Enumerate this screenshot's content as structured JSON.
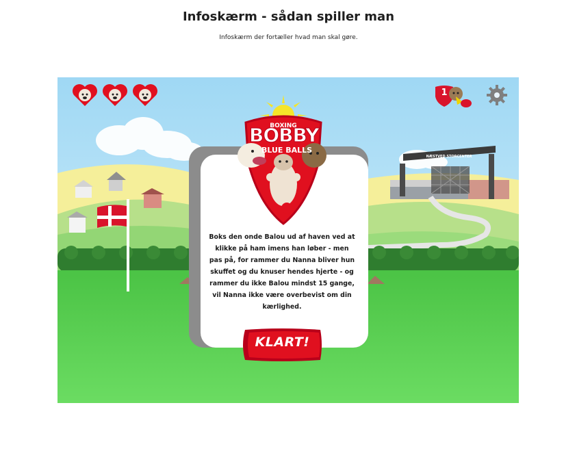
{
  "page": {
    "title": "Infoskærm - sådan spiller man",
    "subtitle": "Infoskærm der fortæller hvad man skal gøre."
  },
  "hud": {
    "lives": 3,
    "score": "1",
    "icons": [
      "heart-dog-icon",
      "heart-dog-icon",
      "heart-dog-icon",
      "shield-score-icon",
      "boxing-dog-icon",
      "gear-icon"
    ]
  },
  "logo": {
    "line1": "BOXING",
    "line2": "BOBBY",
    "line3": "BLUE BALLS"
  },
  "dialog": {
    "text": "Boks den onde Balou ud af haven ved at klikke på ham imens han løber - men pas på, for rammer du Nanna bliver hun skuffet og du knuser hendes hjerte - og rammer du ikke Balou mindst 15 gange, vil Nanna ikke være overbevist om din kærlighed.",
    "button_label": "KLART!"
  },
  "sign": {
    "text": "NÆSTVED STORCENTER"
  },
  "colors": {
    "sky": "#a8dcf5",
    "grass": "#66d65f",
    "brand_red": "#e0101f",
    "flag_red": "#d9142b"
  }
}
